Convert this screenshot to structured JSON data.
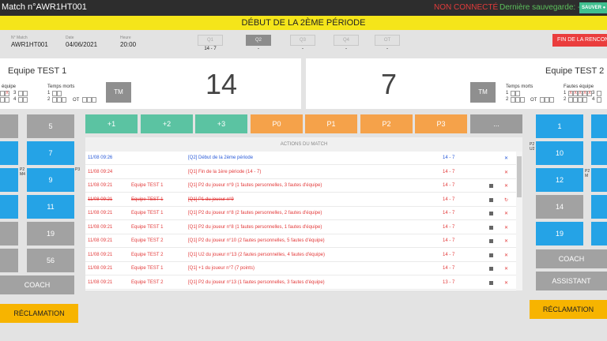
{
  "topbar": {
    "match_title": "Match n°AWR1HT001",
    "connection_status": "NON CONNECTÉ",
    "last_save": "Dernière sauvegarde: --",
    "save_label": "SAUVER ●"
  },
  "banner": "DÉBUT DE LA 2ÈME PÉRIODE",
  "info": {
    "match_no_label": "N° Match",
    "match_no": "AWR1HT001",
    "date_label": "Date",
    "date": "04/06/2021",
    "time_label": "Heure",
    "time": "20:00"
  },
  "quarters": [
    {
      "label": "Q1",
      "score": "14 - 7",
      "active": false
    },
    {
      "label": "Q2",
      "score": "-",
      "active": true
    },
    {
      "label": "Q3",
      "score": "-",
      "active": false
    },
    {
      "label": "Q4",
      "score": "-",
      "active": false
    },
    {
      "label": "OT",
      "score": "-",
      "active": false
    }
  ],
  "end_button": "FIN DE LA RENCONTRE",
  "team_left": {
    "name": "Equipe TEST 1",
    "score": "14",
    "fouls_label": "équipe",
    "timeouts_label": "Temps morts",
    "row1": "1",
    "row2": "2",
    "row3": "3",
    "row4": "4",
    "ot_label": "OT",
    "tm_label": "TM",
    "foul_mark": "X"
  },
  "team_right": {
    "name": "Equipe TEST 2",
    "score": "7",
    "fouls_label": "Fautes équipe",
    "timeouts_label": "Temps morts",
    "row1": "1",
    "row2": "2",
    "row3": "3",
    "row4": "4",
    "ot_label": "OT",
    "tm_label": "TM",
    "foul_mark": "X"
  },
  "actions": [
    {
      "label": "+1",
      "kind": "green"
    },
    {
      "label": "+2",
      "kind": "green"
    },
    {
      "label": "+3",
      "kind": "green"
    },
    {
      "label": "P0",
      "kind": "orange"
    },
    {
      "label": "P1",
      "kind": "orange"
    },
    {
      "label": "P2",
      "kind": "orange"
    },
    {
      "label": "P3",
      "kind": "orange"
    },
    {
      "label": "...",
      "kind": "gray"
    }
  ],
  "log": {
    "header": "ACTIONS DU MATCH",
    "rows": [
      {
        "time": "11/08 09:26",
        "team": "",
        "desc": "[Q2] Début de la 2ème période",
        "score": "14 - 7",
        "color": "blue",
        "strike": false,
        "edit": false,
        "act": "✕"
      },
      {
        "time": "11/08 09:24",
        "team": "",
        "desc": "[Q1] Fin de la 1ère période (14 - 7)",
        "score": "14 - 7",
        "color": "red",
        "strike": false,
        "edit": false,
        "act": "✕"
      },
      {
        "time": "11/08 09:21",
        "team": "Equipe TEST 1",
        "desc": "[Q1] P2 du joueur n°9 (1 fautes personnelles, 3 fautes d'équipe)",
        "score": "14 - 7",
        "color": "red",
        "strike": false,
        "edit": true,
        "act": "✕"
      },
      {
        "time": "11/08 09:21",
        "team": "Equipe TEST 1",
        "desc": "[Q1] P1 du joueur n°9",
        "score": "14 - 7",
        "color": "red",
        "strike": true,
        "edit": true,
        "act": "↻"
      },
      {
        "time": "11/08 09:21",
        "team": "Equipe TEST 1",
        "desc": "[Q1] P2 du joueur n°8 (2 fautes personnelles, 2 fautes d'équipe)",
        "score": "14 - 7",
        "color": "red",
        "strike": false,
        "edit": true,
        "act": "✕"
      },
      {
        "time": "11/08 09:21",
        "team": "Equipe TEST 1",
        "desc": "[Q1] P2 du joueur n°8 (1 fautes personnelles, 1 fautes d'équipe)",
        "score": "14 - 7",
        "color": "red",
        "strike": false,
        "edit": true,
        "act": "✕"
      },
      {
        "time": "11/08 09:21",
        "team": "Equipe TEST 2",
        "desc": "[Q1] P2 du joueur n°10 (2 fautes personnelles, 5 fautes d'équipe)",
        "score": "14 - 7",
        "color": "red",
        "strike": false,
        "edit": true,
        "act": "✕"
      },
      {
        "time": "11/08 09:21",
        "team": "Equipe TEST 2",
        "desc": "[Q1] U2 du joueur n°13 (2 fautes personnelles, 4 fautes d'équipe)",
        "score": "14 - 7",
        "color": "red",
        "strike": false,
        "edit": true,
        "act": "✕"
      },
      {
        "time": "11/08 09:21",
        "team": "Equipe TEST 1",
        "desc": "[Q1] +1 du joueur n°7 (7 points)",
        "score": "14 - 7",
        "color": "red",
        "strike": false,
        "edit": true,
        "act": "✕"
      },
      {
        "time": "11/08 09:21",
        "team": "Equipe TEST 2",
        "desc": "[Q1] P2 du joueur n°13 (1 fautes personnelles, 3 fautes d'équipe)",
        "score": "13 - 7",
        "color": "red",
        "strike": false,
        "edit": true,
        "act": "✕"
      }
    ]
  },
  "left_players": {
    "col2": [
      "5",
      "7",
      "9",
      "11",
      "19",
      "56"
    ],
    "marks": {
      "p2": "P2",
      "m4": "M4",
      "p3": "P3"
    },
    "coach": "COACH",
    "reclamation": "RÉCLAMATION"
  },
  "right_players": {
    "col1": [
      "1",
      "10",
      "12",
      "14",
      "19"
    ],
    "marks": {
      "p2a": "P2",
      "u2": "U2",
      "p2b": "P2",
      "m": "M"
    },
    "coach": "COACH",
    "assistant": "ASSISTANT",
    "reclamation": "RÉCLAMATION"
  },
  "colors": {
    "blue": "#25a3e6",
    "gray": "#a2a2a2",
    "green": "#5bc3a2",
    "orange": "#f5a24a",
    "yellow": "#f5e51a",
    "red": "#ea3d3d"
  }
}
